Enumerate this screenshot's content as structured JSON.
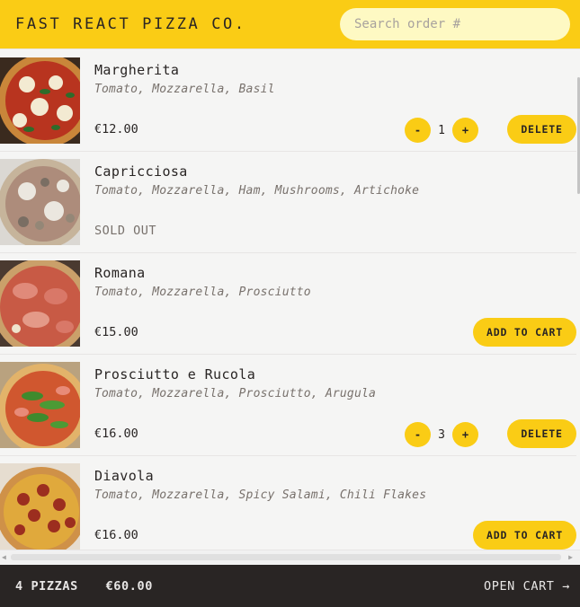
{
  "header": {
    "brand": "FAST REACT PIZZA CO.",
    "search_placeholder": "Search order #",
    "accent": "#facc15"
  },
  "menu": {
    "items": [
      {
        "name": "Margherita",
        "ingredients": "Tomato, Mozzarella, Basil",
        "price": "€12.00",
        "sold_out": false,
        "in_cart": true,
        "quantity": "1",
        "decrease": "-",
        "increase": "+",
        "action": "DELETE"
      },
      {
        "name": "Capricciosa",
        "ingredients": "Tomato, Mozzarella, Ham, Mushrooms, Artichoke",
        "status": "SOLD OUT",
        "sold_out": true
      },
      {
        "name": "Romana",
        "ingredients": "Tomato, Mozzarella, Prosciutto",
        "price": "€15.00",
        "sold_out": false,
        "in_cart": false,
        "action": "ADD TO CART"
      },
      {
        "name": "Prosciutto e Rucola",
        "ingredients": "Tomato, Mozzarella, Prosciutto, Arugula",
        "price": "€16.00",
        "sold_out": false,
        "in_cart": true,
        "quantity": "3",
        "decrease": "-",
        "increase": "+",
        "action": "DELETE"
      },
      {
        "name": "Diavola",
        "ingredients": "Tomato, Mozzarella, Spicy Salami, Chili Flakes",
        "price": "€16.00",
        "sold_out": false,
        "in_cart": false,
        "action": "ADD TO CART"
      }
    ]
  },
  "cart": {
    "count": "4 PIZZAS",
    "total": "€60.00",
    "open_label": "OPEN CART →",
    "background": "#292524"
  },
  "scrollbar": {
    "left_arrow": "◀",
    "right_arrow": "▶"
  }
}
